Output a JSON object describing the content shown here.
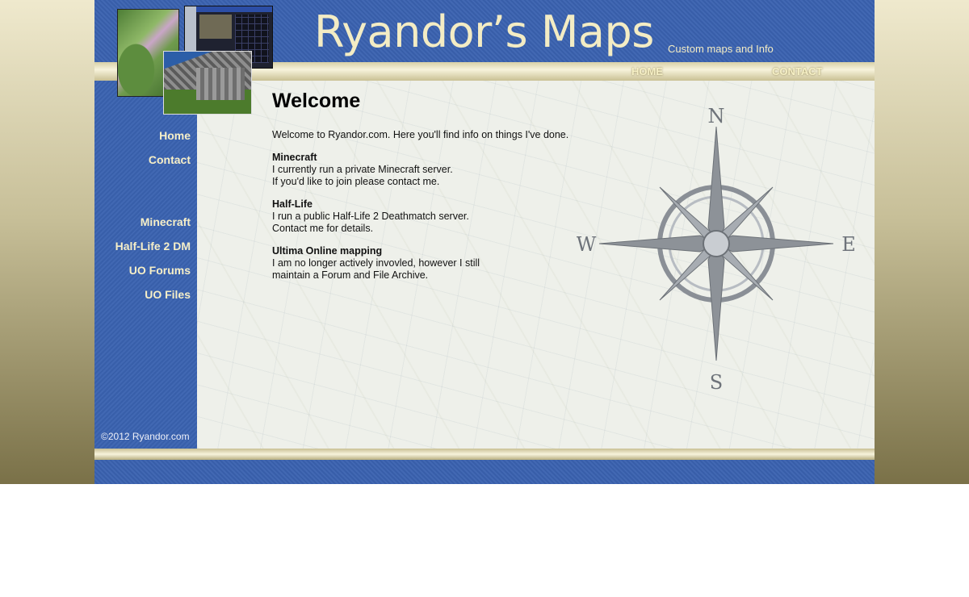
{
  "header": {
    "title": "Ryandor’s Maps",
    "tagline": "Custom maps and Info"
  },
  "top_nav": {
    "home": "HOME",
    "contact": "CONTACT"
  },
  "sidebar": {
    "items": [
      {
        "label": "Home"
      },
      {
        "label": "Contact"
      },
      {
        "label": "Minecraft"
      },
      {
        "label": "Half-Life 2 DM"
      },
      {
        "label": "UO Forums"
      },
      {
        "label": "UO Files"
      }
    ],
    "copyright": "©2012 Ryandor.com"
  },
  "main": {
    "heading": "Welcome",
    "intro": "Welcome to Ryandor.com. Here you'll find info on things I've done.",
    "sections": [
      {
        "title": "Minecraft",
        "lines": [
          "I currently run a private Minecraft server.",
          "If you'd like to join please contact me."
        ]
      },
      {
        "title": "Half-Life",
        "lines": [
          "I run a public Half-Life 2 Deathmatch server.",
          "Contact me for details."
        ]
      },
      {
        "title": "Ultima Online mapping",
        "lines": [
          "I am no longer actively invovled, however I still",
          "maintain a Forum and File Archive."
        ]
      }
    ]
  },
  "compass": {
    "north": "N",
    "south": "S",
    "east": "E",
    "west": "W"
  },
  "colors": {
    "brand_blue": "#3a62b0",
    "cream_text": "#f3ecc4"
  }
}
